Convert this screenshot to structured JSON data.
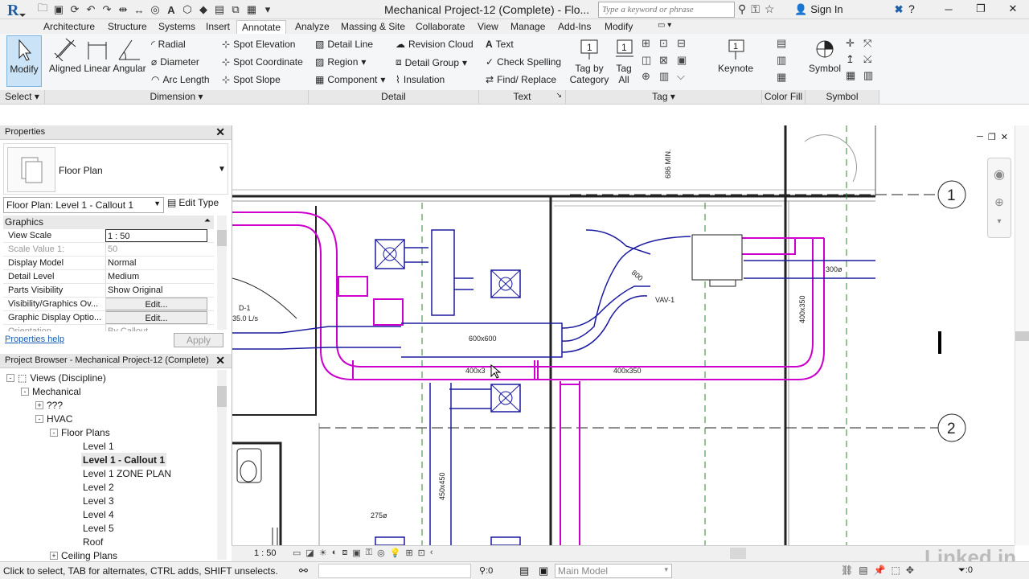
{
  "window": {
    "title": "Mechanical Project-12 (Complete) - Flo...",
    "search_placeholder": "Type a keyword or phrase",
    "sign_in": "Sign In"
  },
  "tabs": [
    "Architecture",
    "Structure",
    "Systems",
    "Insert",
    "Annotate",
    "Analyze",
    "Massing & Site",
    "Collaborate",
    "View",
    "Manage",
    "Add-Ins",
    "Modify"
  ],
  "active_tab": "Annotate",
  "ribbon": {
    "modify": "Modify",
    "aligned": "Aligned",
    "linear": "Linear",
    "angular": "Angular",
    "radial": "Radial",
    "diameter": "Diameter",
    "arc_length": "Arc  Length",
    "spot_elevation": "Spot Elevation",
    "spot_coordinate": "Spot Coordinate",
    "spot_slope": "Spot Slope",
    "detail_line": "Detail  Line",
    "region": "Region",
    "component": "Component",
    "revision_cloud": "Revision  Cloud",
    "detail_group": "Detail  Group",
    "insulation": "Insulation",
    "text": "Text",
    "check_spelling": "Check  Spelling",
    "find_replace": "Find/  Replace",
    "tag_by_category": "Tag by\nCategory",
    "tag_all": "Tag\nAll",
    "keynote": "Keynote",
    "symbol": "Symbol",
    "panels": {
      "select": "Select",
      "dimension": "Dimension",
      "detail": "Detail",
      "text": "Text",
      "tag": "Tag",
      "color_fill": "Color Fill",
      "symbol": "Symbol"
    }
  },
  "properties": {
    "header": "Properties",
    "type_name": "Floor Plan",
    "instance": "Floor Plan: Level 1 - Callout 1",
    "edit_type": "Edit Type",
    "group": "Graphics",
    "rows": [
      {
        "key": "View Scale",
        "value": "1 : 50"
      },
      {
        "key": "Scale Value    1:",
        "value": "50"
      },
      {
        "key": "Display Model",
        "value": "Normal"
      },
      {
        "key": "Detail Level",
        "value": "Medium"
      },
      {
        "key": "Parts Visibility",
        "value": "Show Original"
      },
      {
        "key": "Visibility/Graphics Ov...",
        "value": "Edit..."
      },
      {
        "key": "Graphic Display Optio...",
        "value": "Edit..."
      },
      {
        "key": "Orientation",
        "value": "By Callout"
      }
    ],
    "help": "Properties help",
    "apply": "Apply"
  },
  "project_browser": {
    "header": "Project Browser - Mechanical Project-12 (Complete)",
    "nodes": [
      {
        "label": "Views (Discipline)",
        "level": 0,
        "toggle": "-"
      },
      {
        "label": "Mechanical",
        "level": 1,
        "toggle": "-"
      },
      {
        "label": "???",
        "level": 2,
        "toggle": "+"
      },
      {
        "label": "HVAC",
        "level": 2,
        "toggle": "-"
      },
      {
        "label": "Floor Plans",
        "level": 3,
        "toggle": "-"
      },
      {
        "label": "Level 1",
        "level": 4,
        "toggle": ""
      },
      {
        "label": "Level 1 - Callout 1",
        "level": 4,
        "toggle": "",
        "selected": true
      },
      {
        "label": "Level 1 ZONE PLAN",
        "level": 4,
        "toggle": ""
      },
      {
        "label": "Level 2",
        "level": 4,
        "toggle": ""
      },
      {
        "label": "Level 3",
        "level": 4,
        "toggle": ""
      },
      {
        "label": "Level 4",
        "level": 4,
        "toggle": ""
      },
      {
        "label": "Level 5",
        "level": 4,
        "toggle": ""
      },
      {
        "label": "Roof",
        "level": 4,
        "toggle": ""
      },
      {
        "label": "Ceiling Plans",
        "level": 3,
        "toggle": "+"
      }
    ]
  },
  "drawing": {
    "grid_1": "1",
    "grid_2": "2",
    "dim_686": "686 MIN.",
    "duct_600x600": "600x600",
    "duct_400x350_a": "400x3",
    "duct_400x350_b": "400x350",
    "duct_400x350_v": "400x350",
    "duct_450x450": "450x450",
    "round_300": "300ø",
    "round_800": "800",
    "round_275": "275ø",
    "vav": "VAV-1",
    "d1": "D-1",
    "flow": "35.0 L/s"
  },
  "view_controls": {
    "scale": "1 : 50"
  },
  "status": {
    "message": "Click to select, TAB for alternates, CTRL adds, SHIFT unselects.",
    "count": ":0",
    "model": "Main Model",
    "filter": ":0"
  },
  "watermark": "Linked in"
}
